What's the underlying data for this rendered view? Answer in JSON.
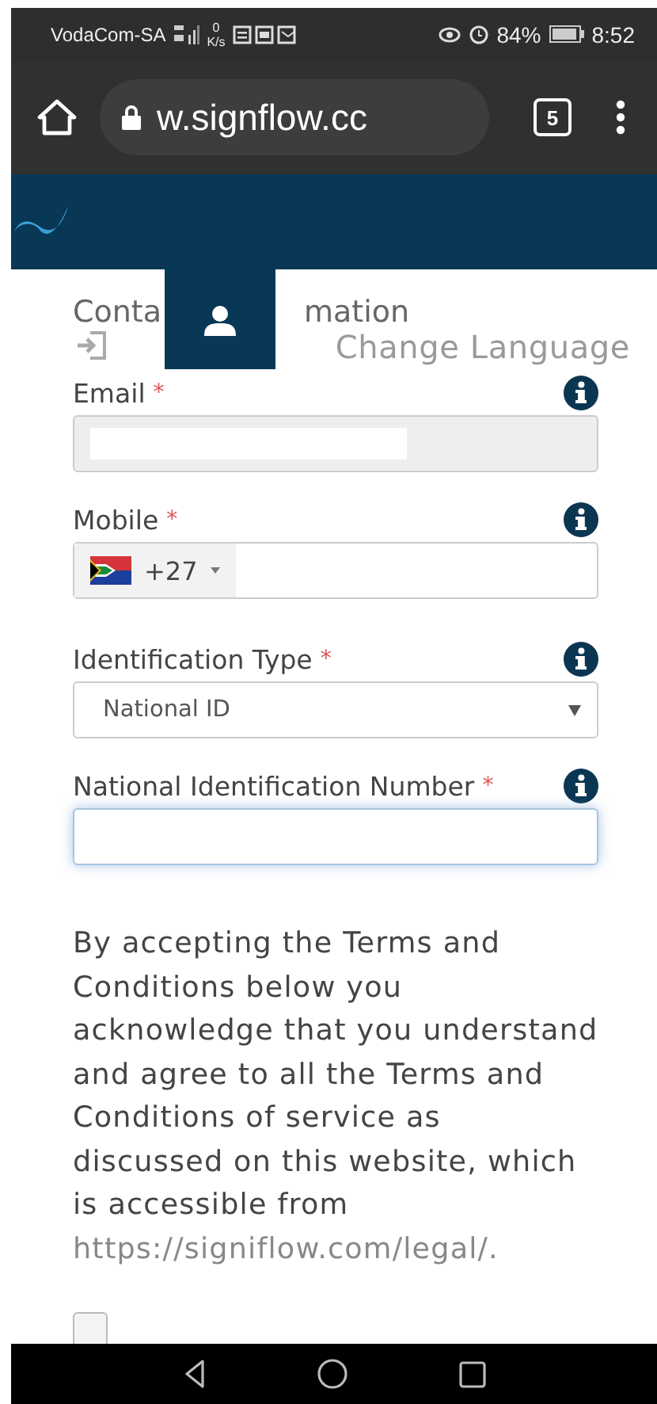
{
  "status_bar": {
    "carrier": "VodaCom-SA",
    "speed_value": "0",
    "speed_unit": "K/s",
    "battery": "84%",
    "time": "8:52"
  },
  "browser": {
    "url": "w.signflow.cc",
    "tab_count": "5"
  },
  "form": {
    "heading_parts": [
      "Conta",
      "mation"
    ],
    "change_language": "Change Language",
    "fields": [
      {
        "kind": "text",
        "label": "Email",
        "required_mark": "*",
        "disabled": true,
        "focused": false,
        "redacted": true
      },
      {
        "kind": "phone",
        "label": "Mobile",
        "required_mark": "*",
        "disabled": false,
        "focused": false,
        "dial_code": "+27"
      },
      {
        "kind": "select",
        "label": "Identification Type",
        "required_mark": "*",
        "disabled": false,
        "focused": false,
        "value": "National ID"
      },
      {
        "kind": "text",
        "label": "National Identification Number",
        "required_mark": "*",
        "disabled": false,
        "focused": true,
        "redacted": false
      }
    ]
  },
  "terms": {
    "text": "By accepting the Terms and Conditions below you acknowledge that you understand and agree to all the Terms and Conditions of service as discussed on this website, which is accessible from ",
    "link": "https://signiflow.com/legal/."
  },
  "accept_checkbox": {
    "checked": false
  }
}
